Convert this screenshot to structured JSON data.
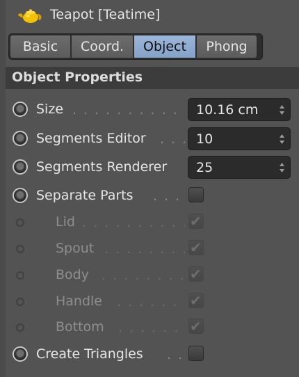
{
  "header": {
    "title": "Teapot [Teatime]",
    "icon": "teapot-icon",
    "icon_color": "#f0c000"
  },
  "tabs": [
    {
      "label": "Basic",
      "active": false
    },
    {
      "label": "Coord.",
      "active": false
    },
    {
      "label": "Object",
      "active": true
    },
    {
      "label": "Phong",
      "active": false
    }
  ],
  "section": {
    "title": "Object Properties"
  },
  "fields": {
    "size": {
      "label": "Size",
      "value": "10.16 cm"
    },
    "segments_editor": {
      "label": "Segments Editor",
      "value": "10"
    },
    "segments_renderer": {
      "label": "Segments Renderer",
      "value": "25"
    }
  },
  "checks": {
    "separate_parts": {
      "label": "Separate Parts",
      "checked": false
    },
    "lid": {
      "label": "Lid",
      "checked": true,
      "disabled": true
    },
    "spout": {
      "label": "Spout",
      "checked": true,
      "disabled": true
    },
    "body": {
      "label": "Body",
      "checked": true,
      "disabled": true
    },
    "handle": {
      "label": "Handle",
      "checked": true,
      "disabled": true
    },
    "bottom": {
      "label": "Bottom",
      "checked": true,
      "disabled": true
    },
    "create_triangles": {
      "label": "Create Triangles",
      "checked": false
    }
  },
  "colors": {
    "active_tab": "#8fabd0",
    "panel_bg": "#535353",
    "field_bg": "#2b2b2b"
  }
}
